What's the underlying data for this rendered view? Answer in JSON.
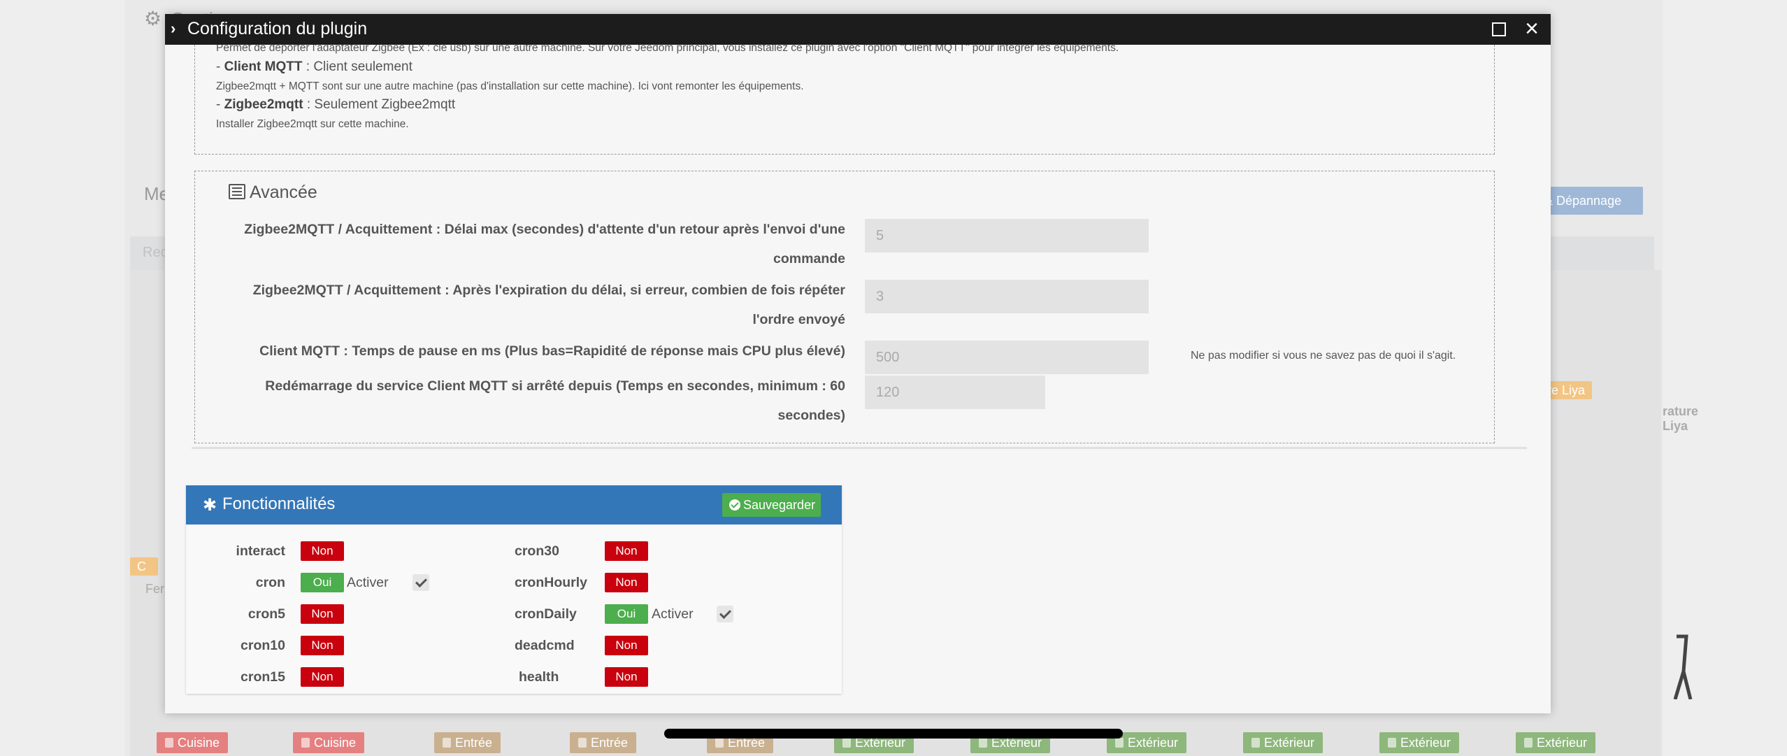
{
  "background": {
    "header_title": "Gestion",
    "section_title": "Me",
    "faq_button": "Q & Dépannage",
    "search_placeholder": "Rec",
    "right_tag": "mbre Liya",
    "right_label": "rature Liya",
    "left_tag": "C",
    "left_label": "Fer",
    "bottom_tags": [
      "Cuisine",
      "Cuisine",
      "Entrée",
      "Entrée",
      "Entrée",
      "Extérieur",
      "Extérieur",
      "Extérieur",
      "Extérieur",
      "Extérieur",
      "Extérieur"
    ]
  },
  "modal": {
    "title": "Configuration du plugin",
    "intro": {
      "line1": "Permet de déporter l'adaptateur Zigbee (Ex : clé usb) sur une autre machine. Sur votre Jeedom principal, vous installez ce plugin avec l'option \"Client MQTT\" pour intégrer les équipements.",
      "client_label": "Client MQTT",
      "client_desc": " : Client seulement",
      "line3": "Zigbee2mqtt + MQTT sont sur une autre machine (pas d'installation sur cette machine). Ici vont remonter les équipements.",
      "zigbee_label": "Zigbee2mqtt",
      "zigbee_desc": " : Seulement Zigbee2mqtt",
      "line5": "Installer Zigbee2mqtt sur cette machine."
    },
    "advanced": {
      "heading": "Avancée",
      "rows": [
        {
          "label_line1": "Zigbee2MQTT / Acquittement : Délai max (secondes) d'attente d'un retour après l'envoi d'une",
          "label_line2": "commande",
          "value": "5",
          "help": ""
        },
        {
          "label_line1": "Zigbee2MQTT / Acquittement : Après l'expiration du délai, si erreur, combien de fois répéter",
          "label_line2": "l'ordre envoyé",
          "value": "3",
          "help": ""
        },
        {
          "label_line1": "Client MQTT : Temps de pause en ms (Plus bas=Rapidité de réponse mais CPU plus élevé)",
          "label_line2": "",
          "value": "500",
          "help": "Ne pas modifier si vous ne savez pas de quoi il s'agit."
        },
        {
          "label_line1": "Redémarrage du service Client MQTT si arrêté depuis (Temps en secondes, minimum : 60",
          "label_line2": "secondes)",
          "value": "120",
          "help": ""
        }
      ]
    },
    "features": {
      "title": "Fonctionnalités",
      "save_label": "Sauvegarder",
      "activer_label": "Activer",
      "left": [
        {
          "name": "interact",
          "status": "Non"
        },
        {
          "name": "cron",
          "status": "Oui",
          "activer": true
        },
        {
          "name": "cron5",
          "status": "Non"
        },
        {
          "name": "cron10",
          "status": "Non"
        },
        {
          "name": "cron15",
          "status": "Non"
        }
      ],
      "right": [
        {
          "name": "cron30",
          "status": "Non"
        },
        {
          "name": "cronHourly",
          "status": "Non"
        },
        {
          "name": "cronDaily",
          "status": "Oui",
          "activer": true
        },
        {
          "name": "deadcmd",
          "status": "Non"
        },
        {
          "name": "health",
          "status": "Non"
        }
      ]
    }
  },
  "colors": {
    "titlebar": "#1c1c1c",
    "panel_header": "#3477b8",
    "non_badge": "#c9000d",
    "oui_badge": "#4cae4c"
  }
}
